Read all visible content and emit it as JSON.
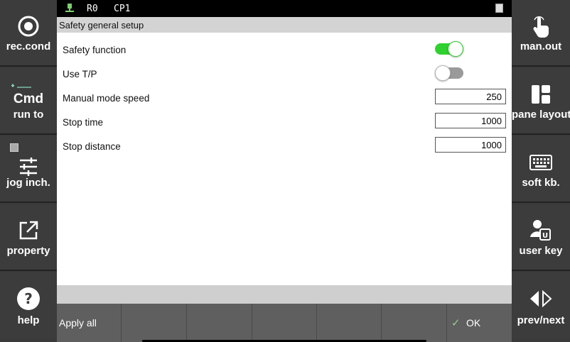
{
  "status_bar": {
    "robot": "R0",
    "program": "CP1"
  },
  "title": "Safety general setup",
  "left_sidebar": [
    {
      "label": "rec.cond",
      "icon": "record-icon"
    },
    {
      "label": "run to",
      "icon_text": "Cmd",
      "icon": "cmd-icon"
    },
    {
      "label": "jog inch.",
      "icon": "sliders-icon"
    },
    {
      "label": "property",
      "icon": "external-link-icon"
    },
    {
      "label": "help",
      "icon": "help-icon"
    }
  ],
  "right_sidebar": [
    {
      "label": "man.out",
      "icon": "hand-pointer-icon"
    },
    {
      "label": "pane layout",
      "icon": "layout-icon"
    },
    {
      "label": "soft kb.",
      "icon": "keyboard-icon"
    },
    {
      "label": "user key",
      "icon": "user-key-icon"
    },
    {
      "label": "prev/next",
      "icon": "prev-next-icon"
    }
  ],
  "settings": {
    "safety_function": {
      "label": "Safety function",
      "enabled": true
    },
    "use_tp": {
      "label": "Use T/P",
      "enabled": false
    },
    "manual_mode_speed": {
      "label": "Manual mode speed",
      "value": "250"
    },
    "stop_time": {
      "label": "Stop time",
      "value": "1000"
    },
    "stop_distance": {
      "label": "Stop distance",
      "value": "1000"
    }
  },
  "bottom_bar": {
    "apply_all": "Apply all",
    "ok": "OK"
  },
  "colors": {
    "toggle_on": "#2fd12f",
    "toggle_off": "#9a9a9a",
    "sidebar": "#3c3c3c"
  }
}
